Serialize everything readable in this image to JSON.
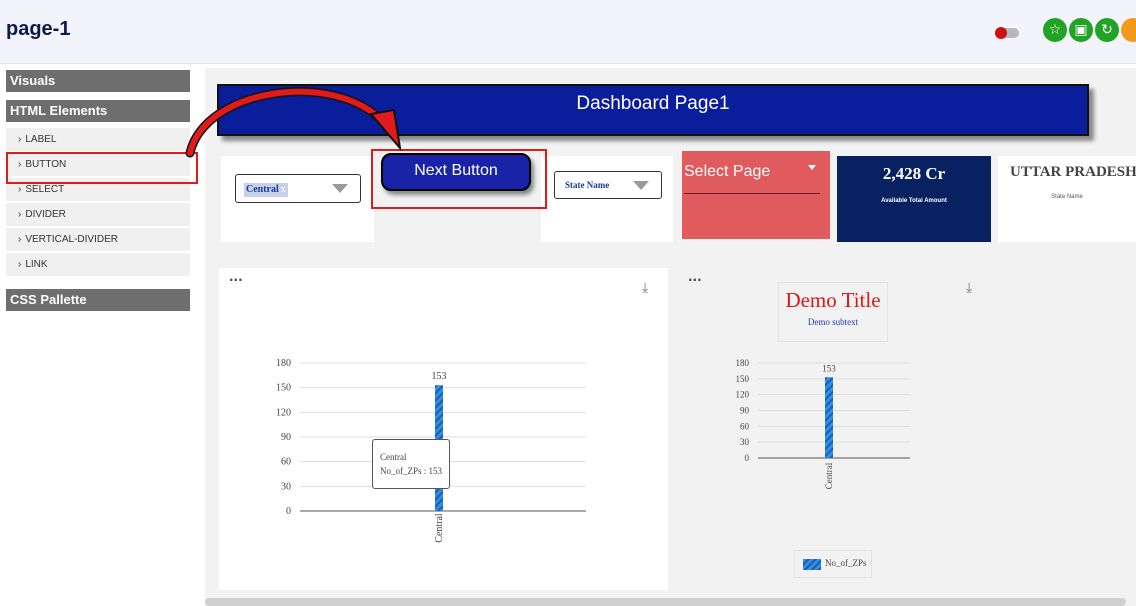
{
  "header": {
    "title": "page-1",
    "icons": [
      "toggle-icon",
      "star-icon",
      "save-icon",
      "refresh-icon"
    ]
  },
  "sidebar": {
    "sections": [
      "Visuals",
      "HTML Elements",
      "CSS Pallette"
    ],
    "items": [
      {
        "label": "LABEL"
      },
      {
        "label": "BUTTON"
      },
      {
        "label": "SELECT"
      },
      {
        "label": "DIVIDER"
      },
      {
        "label": "VERTICAL-DIVIDER"
      },
      {
        "label": "LINK"
      }
    ],
    "chevron": "›"
  },
  "banner": {
    "title": "Dashboard Page1"
  },
  "filters": {
    "zone_chip": "Central",
    "chip_remove": "x",
    "state_placeholder": "State Name",
    "next_button": "Next Button",
    "select_page": "Select Page"
  },
  "kpi": {
    "value": "2,428 Cr",
    "label": "Available Total Amount"
  },
  "state_card": {
    "value": "UTTAR PRADESH",
    "label": "State Name"
  },
  "menu_dots": "...",
  "download_icon": "⤓",
  "tooltip": {
    "line1": "Central",
    "line2": "No_of_ZPs : 153"
  },
  "demo": {
    "title": "Demo Title",
    "subtitle": "Demo subtext"
  },
  "colors": {
    "accent": "#1a22a8",
    "bar": "#2f8fe6",
    "highlight": "#e01b1b",
    "kpi": "#082261",
    "select_page": "#e05b5e"
  },
  "chart_data": [
    {
      "type": "bar",
      "title": "",
      "categories": [
        "Central"
      ],
      "series": [
        {
          "name": "No_of_ZPs",
          "values": [
            153
          ]
        }
      ],
      "ylim": [
        0,
        180
      ],
      "yticks": [
        0,
        30,
        60,
        90,
        120,
        150,
        180
      ],
      "data_labels": [
        "153"
      ],
      "grid": true
    },
    {
      "type": "bar",
      "title": "Demo Title",
      "subtitle": "Demo subtext",
      "categories": [
        "Central"
      ],
      "series": [
        {
          "name": "No_of_ZPs",
          "values": [
            153
          ]
        }
      ],
      "ylim": [
        0,
        180
      ],
      "yticks": [
        0,
        30,
        60,
        90,
        120,
        150,
        180
      ],
      "data_labels": [
        "153"
      ],
      "legend": "bottom",
      "grid": true
    }
  ]
}
